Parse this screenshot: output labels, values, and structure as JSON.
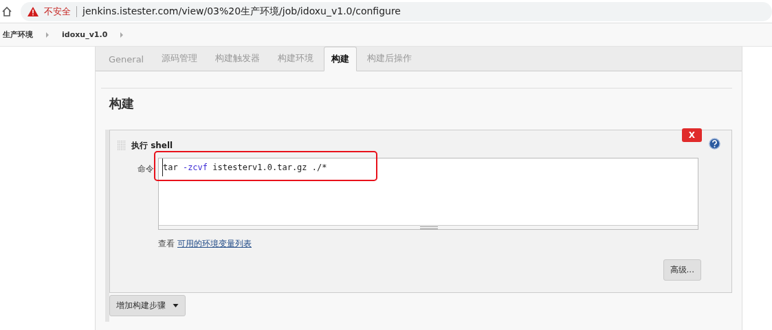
{
  "browser": {
    "security_label": "不安全",
    "url": "jenkins.istester.com/view/03%20生产环境/job/idoxu_v1.0/configure"
  },
  "breadcrumbs": [
    "生产环境",
    "idoxu_v1.0"
  ],
  "tabs": [
    {
      "label": "General",
      "selected": false
    },
    {
      "label": "源码管理",
      "selected": false
    },
    {
      "label": "构建触发器",
      "selected": false
    },
    {
      "label": "构建环境",
      "selected": false
    },
    {
      "label": "构建",
      "selected": true
    },
    {
      "label": "构建后操作",
      "selected": false
    }
  ],
  "section_title": "构建",
  "step": {
    "title": "执行 shell",
    "delete_label": "X",
    "command_label": "命令",
    "command": [
      {
        "text": "tar",
        "kind": "plain"
      },
      {
        "text": "-zcvf",
        "kind": "option"
      },
      {
        "text": "istesterv1.0.tar.gz",
        "kind": "plain"
      },
      {
        "text": "./*",
        "kind": "plain"
      }
    ],
    "env_prefix": "查看",
    "env_link": "可用的环境变量列表",
    "advanced_button": "高级..."
  },
  "add_step_button": "增加构建步骤"
}
